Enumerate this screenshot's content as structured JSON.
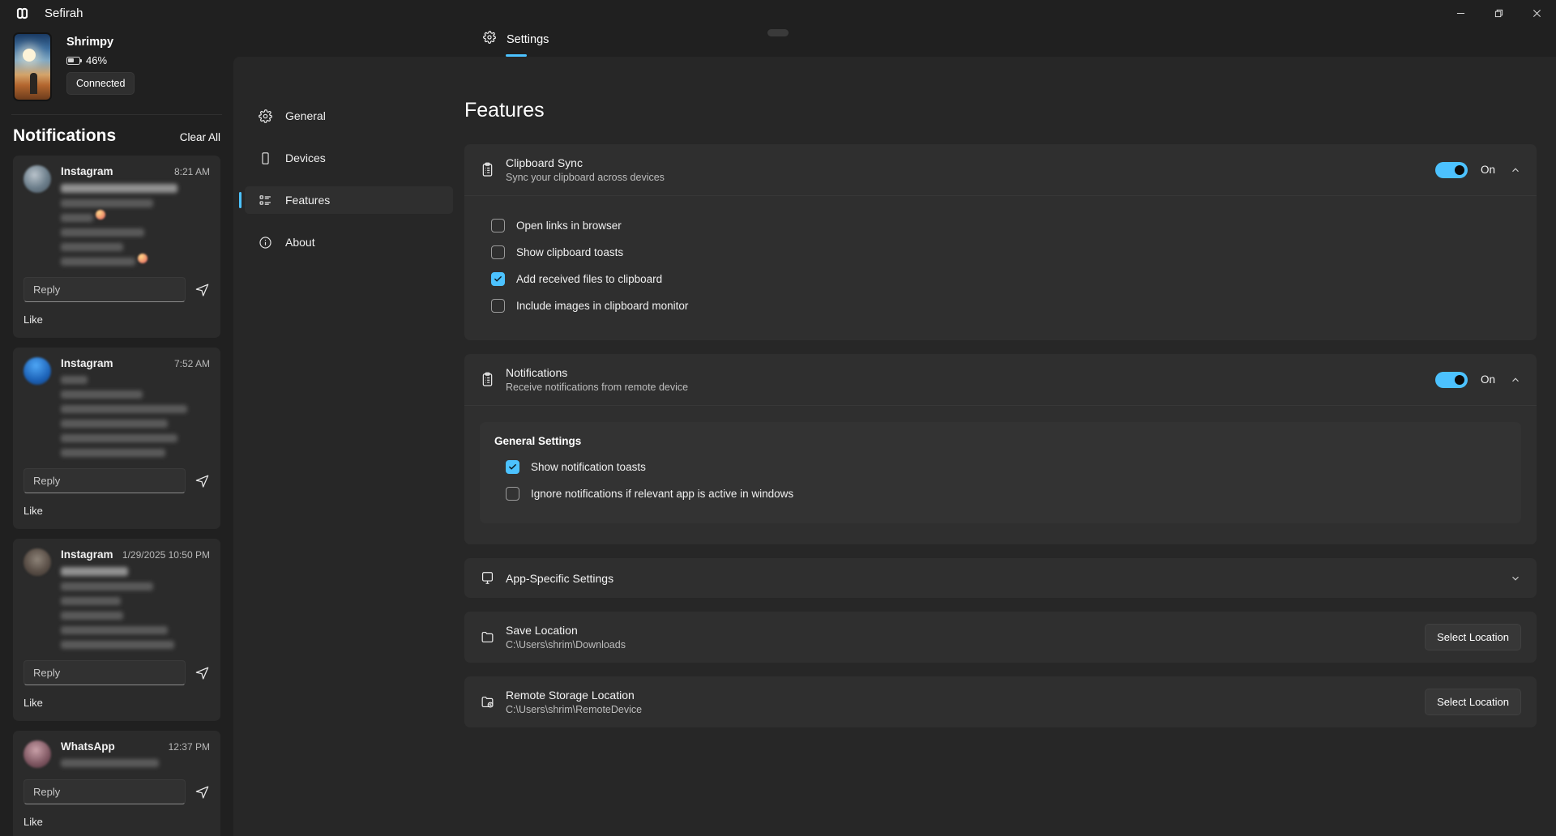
{
  "window": {
    "app_title": "Sefirah",
    "logo_icon": "sefirah-logo",
    "controls": {
      "minimize": "minimize-icon",
      "maximize": "restore-icon",
      "close": "close-icon"
    }
  },
  "device": {
    "name": "Shrimpy",
    "battery_percent": "46%",
    "battery_icon": "battery-icon",
    "status": "Connected",
    "thumbnail": "device-wallpaper-thumbnail"
  },
  "notifications_panel": {
    "title": "Notifications",
    "clear_all": "Clear All",
    "reply_placeholder": "Reply",
    "like_label": "Like",
    "send_icon": "send-icon",
    "items": [
      {
        "app": "Instagram",
        "time": "8:21 AM",
        "avatar": "a1",
        "lines": [
          {
            "w": "78%",
            "strong": true
          },
          {
            "w": "62%",
            "strong": false
          },
          {
            "w": "22%",
            "strong": false,
            "emoji": true
          },
          {
            "w": "56%",
            "strong": false
          },
          {
            "w": "42%",
            "strong": false
          },
          {
            "w": "50%",
            "strong": false,
            "emoji": true
          }
        ]
      },
      {
        "app": "Instagram",
        "time": "7:52 AM",
        "avatar": "a2",
        "lines": [
          {
            "w": "18%",
            "strong": false
          },
          {
            "w": "55%",
            "strong": false
          },
          {
            "w": "85%",
            "strong": false
          },
          {
            "w": "72%",
            "strong": false
          },
          {
            "w": "78%",
            "strong": false
          },
          {
            "w": "70%",
            "strong": false
          }
        ]
      },
      {
        "app": "Instagram",
        "time": "1/29/2025 10:50 PM",
        "avatar": "a3",
        "lines": [
          {
            "w": "45%",
            "strong": true
          },
          {
            "w": "62%",
            "strong": false
          },
          {
            "w": "40%",
            "strong": false
          },
          {
            "w": "42%",
            "strong": false
          },
          {
            "w": "72%",
            "strong": false
          },
          {
            "w": "76%",
            "strong": false
          }
        ]
      },
      {
        "app": "WhatsApp",
        "time": "12:37 PM",
        "avatar": "a4",
        "lines": [
          {
            "w": "66%",
            "strong": false
          }
        ]
      }
    ]
  },
  "settings_tab": {
    "label": "Settings",
    "icon": "gear-icon"
  },
  "nav": {
    "items": [
      {
        "label": "General",
        "icon": "gear-icon",
        "selected": false
      },
      {
        "label": "Devices",
        "icon": "phone-icon",
        "selected": false
      },
      {
        "label": "Features",
        "icon": "list-icon",
        "selected": true
      },
      {
        "label": "About",
        "icon": "info-icon",
        "selected": false
      }
    ]
  },
  "page": {
    "title": "Features"
  },
  "clipboard_sync": {
    "title": "Clipboard Sync",
    "subtitle": "Sync your clipboard across devices",
    "icon": "clipboard-icon",
    "toggle_state": "On",
    "toggle_on": true,
    "chevron": "chevron-up-icon",
    "options": [
      {
        "label": "Open links in browser",
        "checked": false
      },
      {
        "label": "Show clipboard toasts",
        "checked": false
      },
      {
        "label": "Add received files to clipboard",
        "checked": true
      },
      {
        "label": "Include images in clipboard monitor",
        "checked": false
      }
    ]
  },
  "notifications_feature": {
    "title": "Notifications",
    "subtitle": "Receive notifications from remote device",
    "icon": "clipboard-icon",
    "toggle_state": "On",
    "toggle_on": true,
    "chevron": "chevron-up-icon",
    "general_settings": {
      "title": "General Settings",
      "options": [
        {
          "label": "Show notification toasts",
          "checked": true
        },
        {
          "label": "Ignore notifications if relevant app is active in windows",
          "checked": false
        }
      ]
    },
    "app_specific": {
      "label": "App-Specific Settings",
      "icon": "monitor-icon",
      "chevron": "chevron-down-icon"
    }
  },
  "save_location": {
    "title": "Save Location",
    "path": "C:\\Users\\shrim\\Downloads",
    "icon": "folder-icon",
    "button": "Select Location"
  },
  "remote_storage_location": {
    "title": "Remote Storage Location",
    "path": "C:\\Users\\shrim\\RemoteDevice",
    "icon": "folder-sync-icon",
    "button": "Select Location"
  },
  "colors": {
    "accent": "#4cc2ff",
    "window_bg": "#202020",
    "panel_bg": "#272727",
    "card_bg": "#2f2f2f",
    "subpanel_bg": "#333333"
  }
}
